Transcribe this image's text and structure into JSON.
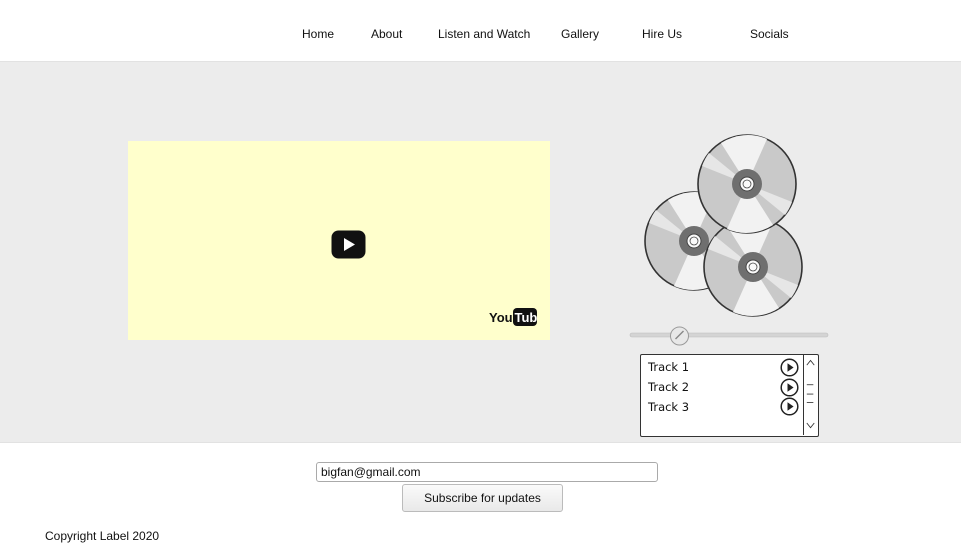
{
  "nav": {
    "items": [
      {
        "label": "Home"
      },
      {
        "label": "About"
      },
      {
        "label": "Listen and Watch"
      },
      {
        "label": "Gallery"
      },
      {
        "label": "Hire Us"
      },
      {
        "label": "Socials"
      }
    ]
  },
  "video": {
    "logo_text": "YouTube",
    "icons": [
      "play-icon",
      "youtube-logo"
    ],
    "background_color": "#ffffcc"
  },
  "player": {
    "icons": [
      "cd-disc-icon",
      "slider-thumb"
    ],
    "progress": 0.25,
    "tracks": [
      {
        "label": "Track 1"
      },
      {
        "label": "Track 2"
      },
      {
        "label": "Track 3"
      }
    ]
  },
  "subscribe": {
    "email_value": "bigfan@gmail.com",
    "button_label": "Subscribe for updates"
  },
  "footer": {
    "copyright": "Copyright Label 2020"
  }
}
